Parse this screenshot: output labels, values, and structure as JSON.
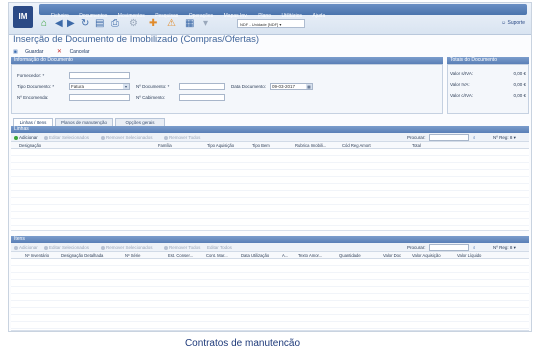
{
  "app": {
    "logo": "IM",
    "menu": [
      "Ficheiro",
      "Documentos",
      "Movimentos",
      "Pesquisas",
      "Operações",
      "Mapas Inv.",
      "Plano",
      "Utilitários",
      "Ajuda"
    ],
    "toolbar_icons": [
      "home-icon",
      "back-icon",
      "forward-icon",
      "refresh-icon",
      "document-icon",
      "print-icon",
      "settings-icon",
      "add-icon",
      "warning-icon",
      "chart-icon",
      "filter-icon"
    ],
    "unit_select": "NDF - Unidade [NDF] ▾",
    "support_label": "Suporte"
  },
  "page": {
    "title": "Inserção de Documento de Imobilizado (Compras/Ofertas)",
    "save_label": "Guardar",
    "cancel_label": "Cancelar"
  },
  "doc_info": {
    "header": "Informação do Documento",
    "fornecedor_label": "Fornecedor: *",
    "fornecedor_value": "",
    "tipo_label": "Tipo Documento: *",
    "tipo_value": "Fatura",
    "numdoc_label": "Nº Documento: *",
    "numdoc_value": "",
    "data_label": "Data Documento:",
    "data_value": "09-03-2017",
    "encomenda_label": "Nº Encomenda:",
    "encomenda_value": "",
    "cabimento_label": "Nº Cabimento:",
    "cabimento_value": ""
  },
  "totals": {
    "header": "Totais do Documento",
    "rows": [
      {
        "label": "Valor s/IVA:",
        "value": "0,00 €"
      },
      {
        "label": "Valor IVA:",
        "value": "0,00 €"
      },
      {
        "label": "Valor c/IVA:",
        "value": "0,00 €"
      }
    ]
  },
  "tabs": [
    "Linhas / Itens",
    "Planos de manutenção",
    "Opções gerais"
  ],
  "linhas": {
    "header": "Linhas",
    "add_label": "Adicionar",
    "edit_label": "Editar Selecionados",
    "remove_label": "Remover Selecionados",
    "remove_all_label": "Remover Todos",
    "search_label": "Procurar:",
    "page_size": "Nº Reg: 8 ▾",
    "columns": [
      "Designação",
      "Família",
      "Tipo Aquisição",
      "Tipo Bem",
      "Rubrica Imobili...",
      "Cód Reg Amort",
      "Total"
    ]
  },
  "itens": {
    "header": "Itens",
    "add_label": "Adicionar",
    "edit_label": "Editar Selecionados",
    "remove_label": "Remover Selecionados",
    "remove_all_label": "Remover Todos",
    "edit_all_label": "Editar Todos",
    "search_label": "Procurar:",
    "page_size": "Nº Reg: 8 ▾",
    "columns": [
      "Nº Inventário",
      "Designação Detalhada",
      "Nº Série",
      "Est. Conser...",
      "Cont. Mar...",
      "Data Utilização",
      "A...",
      "Texto Amor...",
      "Quantidade",
      "Valor Doc",
      "Valor Aquisição",
      "Valor Líquido"
    ]
  },
  "caption": "Contratos de manutencão"
}
